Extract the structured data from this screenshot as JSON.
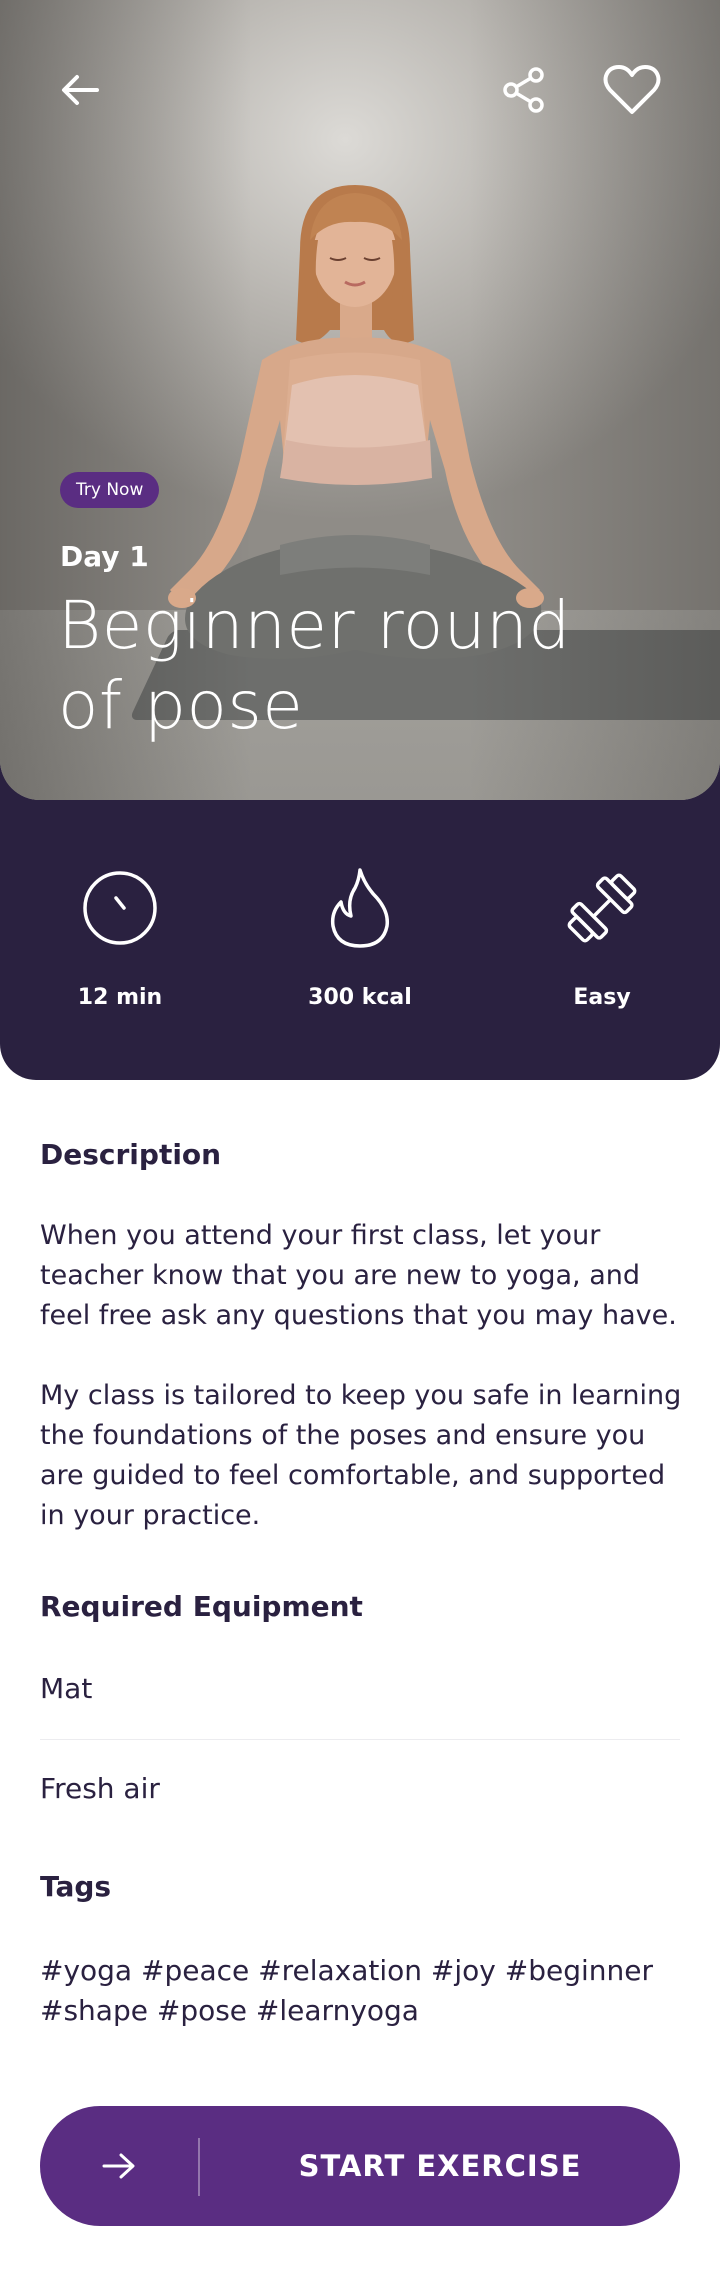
{
  "hero": {
    "badge": "Try Now",
    "day": "Day 1",
    "title": "Beginner round of pose"
  },
  "header": {
    "back_icon": "arrow-left-icon",
    "share_icon": "share-icon",
    "favorite_icon": "heart-icon"
  },
  "stats": [
    {
      "icon": "clock-icon",
      "label": "12 min"
    },
    {
      "icon": "flame-icon",
      "label": "300 kcal"
    },
    {
      "icon": "dumbbell-icon",
      "label": "Easy"
    }
  ],
  "description": {
    "title": "Description",
    "paragraphs": [
      "When you attend your first class, let your teacher know that you are new to yoga, and feel free ask any questions that you may have.",
      "My class is tailored to keep you safe in learning the foundations of the poses and ensure you are guided to feel comfortable, and supported in your practice."
    ]
  },
  "equipment": {
    "title": "Required Equipment",
    "items": [
      "Mat",
      "Fresh air"
    ]
  },
  "tags": {
    "title": "Tags",
    "text": "#yoga #peace #relaxation #joy #beginner #shape #pose #learnyoga"
  },
  "cta": {
    "label": "START EXERCISE",
    "icon": "arrow-right-icon"
  },
  "colors": {
    "primary": "#5a2d82",
    "dark": "#2a2140",
    "white": "#ffffff"
  }
}
